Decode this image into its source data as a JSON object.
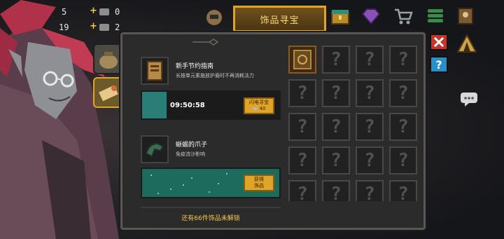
{
  "resources": {
    "left_count_1": "5",
    "left_count_2": "19",
    "res_count_1": "0",
    "res_count_2": "2"
  },
  "top_tab": {
    "label": "饰品寻宝"
  },
  "icons": {
    "top": [
      "treasure-chest-icon",
      "gem-icon",
      "shopping-cart-icon",
      "stack-icon",
      "character-icon"
    ],
    "side": [
      "close-icon",
      "camp-tent-icon",
      "help-icon",
      "chat-icon"
    ]
  },
  "items": [
    {
      "name": "新手节约指南",
      "description": "长按单元素施放护盾时不再消耗法力",
      "icon": "scroll-book-icon"
    },
    {
      "name": "蜥蜴的爪子",
      "description": "免疫流沙影响",
      "icon": "lizard-claw-icon"
    }
  ],
  "timer": {
    "time": "09:50:58",
    "progress": 0.18,
    "button_label": "闪电寻宝",
    "cost": "40"
  },
  "obtain_button": {
    "label_line1": "获得",
    "label_line2": "饰品"
  },
  "unlock_note": "还有66件饰品未解锁",
  "grid": {
    "columns": 4,
    "rows": 5,
    "owned_index": 0,
    "unknown_glyph": "?"
  },
  "colors": {
    "accent_gold": "#e0a526",
    "timer_fill": "#2a7e78",
    "green_bar": "#1c6b5d",
    "note_text": "#f2c94c"
  }
}
